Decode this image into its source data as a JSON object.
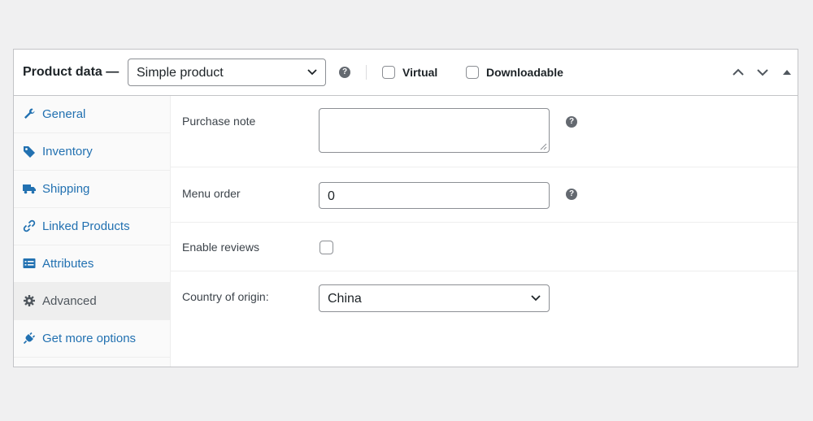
{
  "header": {
    "title": "Product data —",
    "product_type": "Simple product",
    "virtual_label": "Virtual",
    "downloadable_label": "Downloadable",
    "help_glyph": "?"
  },
  "sidebar": {
    "items": [
      {
        "label": "General",
        "icon": "wrench-icon"
      },
      {
        "label": "Inventory",
        "icon": "tag-icon"
      },
      {
        "label": "Shipping",
        "icon": "truck-icon"
      },
      {
        "label": "Linked Products",
        "icon": "link-icon"
      },
      {
        "label": "Attributes",
        "icon": "list-icon"
      },
      {
        "label": "Advanced",
        "icon": "gear-icon",
        "active": true
      },
      {
        "label": "Get more options",
        "icon": "plugin-icon"
      }
    ]
  },
  "form": {
    "purchase_note": {
      "label": "Purchase note",
      "value": ""
    },
    "menu_order": {
      "label": "Menu order",
      "value": "0"
    },
    "enable_reviews": {
      "label": "Enable reviews",
      "checked": false
    },
    "country_of_origin": {
      "label": "Country of origin:",
      "value": "China"
    }
  },
  "colors": {
    "link": "#2271b1",
    "border": "#c3c4c7",
    "background": "#f0f0f1",
    "sidebar_bg": "#fafafa",
    "active_tab_bg": "#eeeeee"
  }
}
